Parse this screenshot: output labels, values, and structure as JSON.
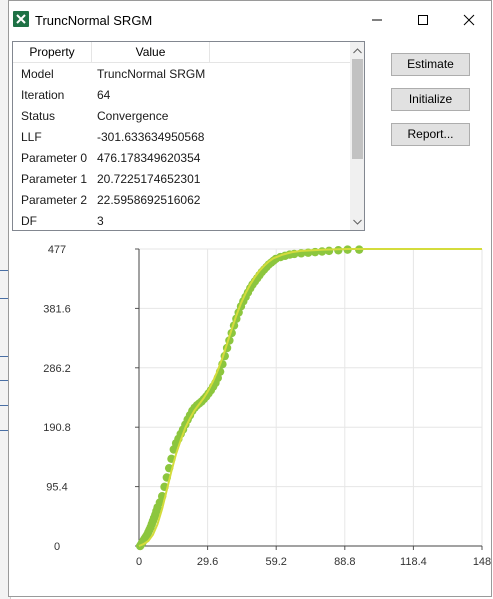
{
  "window": {
    "title": "TruncNormal SRGM"
  },
  "grid": {
    "headers": {
      "property": "Property",
      "value": "Value"
    },
    "rows": [
      {
        "property": "Model",
        "value": "TruncNormal SRGM"
      },
      {
        "property": "Iteration",
        "value": "64"
      },
      {
        "property": "Status",
        "value": "Convergence"
      },
      {
        "property": "LLF",
        "value": "-301.633634950568"
      },
      {
        "property": "Parameter 0",
        "value": "476.178349620354"
      },
      {
        "property": "Parameter 1",
        "value": "20.7225174652301"
      },
      {
        "property": "Parameter 2",
        "value": "22.5958692516062"
      },
      {
        "property": "DF",
        "value": "3"
      }
    ]
  },
  "buttons": {
    "estimate": "Estimate",
    "initialize": "Initialize",
    "report": "Report..."
  },
  "colors": {
    "data_points": "#8cc63e",
    "fitted_line": "#d4dc3c",
    "grid": "#e6e6e6"
  },
  "chart_data": {
    "type": "scatter",
    "x_ticks": [
      "0",
      "29.6",
      "59.2",
      "88.8",
      "118.4",
      "148"
    ],
    "y_ticks": [
      "477",
      "381.6",
      "286.2",
      "190.8",
      "95.4",
      "0"
    ],
    "xlim": [
      0,
      148
    ],
    "ylim": [
      0,
      477
    ],
    "grid": true,
    "series": [
      {
        "type": "scatter",
        "points": [
          [
            0.5,
            0
          ],
          [
            1,
            3
          ],
          [
            1.5,
            6
          ],
          [
            2,
            9
          ],
          [
            2.5,
            12
          ],
          [
            3,
            15
          ],
          [
            3.5,
            18
          ],
          [
            4,
            22
          ],
          [
            4.5,
            26
          ],
          [
            5,
            30
          ],
          [
            5.5,
            35
          ],
          [
            6,
            40
          ],
          [
            6.5,
            45
          ],
          [
            7,
            50
          ],
          [
            7.5,
            56
          ],
          [
            8,
            62
          ],
          [
            9,
            70
          ],
          [
            10,
            80
          ],
          [
            11,
            95
          ],
          [
            12,
            110
          ],
          [
            13,
            125
          ],
          [
            14,
            140
          ],
          [
            15,
            155
          ],
          [
            16,
            165
          ],
          [
            17,
            172
          ],
          [
            18,
            180
          ],
          [
            19,
            187
          ],
          [
            20,
            195
          ],
          [
            21,
            203
          ],
          [
            22,
            210
          ],
          [
            23,
            217
          ],
          [
            24,
            222
          ],
          [
            25,
            226
          ],
          [
            26,
            229
          ],
          [
            27,
            232
          ],
          [
            28,
            236
          ],
          [
            29,
            240
          ],
          [
            30,
            245
          ],
          [
            31,
            250
          ],
          [
            32,
            256
          ],
          [
            33,
            262
          ],
          [
            34,
            270
          ],
          [
            35,
            280
          ],
          [
            36,
            292
          ],
          [
            37,
            305
          ],
          [
            38,
            318
          ],
          [
            39,
            330
          ],
          [
            40,
            342
          ],
          [
            41,
            354
          ],
          [
            42,
            365
          ],
          [
            43,
            375
          ],
          [
            44,
            385
          ],
          [
            45,
            393
          ],
          [
            46,
            400
          ],
          [
            47,
            407
          ],
          [
            48,
            414
          ],
          [
            49,
            420
          ],
          [
            50,
            425
          ],
          [
            51,
            430
          ],
          [
            52,
            435
          ],
          [
            53,
            440
          ],
          [
            54,
            444
          ],
          [
            55,
            448
          ],
          [
            56,
            452
          ],
          [
            57,
            455
          ],
          [
            58,
            458
          ],
          [
            59,
            461
          ],
          [
            61,
            464
          ],
          [
            63,
            466
          ],
          [
            65,
            468
          ],
          [
            67,
            469
          ],
          [
            70,
            470
          ],
          [
            73,
            471
          ],
          [
            76,
            472
          ],
          [
            79,
            473
          ],
          [
            82,
            474
          ],
          [
            86,
            475
          ],
          [
            90,
            476
          ],
          [
            95,
            476
          ]
        ]
      },
      {
        "type": "line",
        "points": [
          [
            0,
            0
          ],
          [
            2,
            3
          ],
          [
            4,
            8
          ],
          [
            6,
            18
          ],
          [
            8,
            35
          ],
          [
            10,
            60
          ],
          [
            12,
            90
          ],
          [
            14,
            120
          ],
          [
            16,
            148
          ],
          [
            18,
            170
          ],
          [
            20,
            190
          ],
          [
            22,
            205
          ],
          [
            24,
            218
          ],
          [
            26,
            228
          ],
          [
            28,
            238
          ],
          [
            30,
            250
          ],
          [
            32,
            265
          ],
          [
            34,
            282
          ],
          [
            36,
            302
          ],
          [
            38,
            325
          ],
          [
            40,
            348
          ],
          [
            42,
            370
          ],
          [
            44,
            390
          ],
          [
            46,
            406
          ],
          [
            48,
            420
          ],
          [
            50,
            432
          ],
          [
            52,
            442
          ],
          [
            54,
            450
          ],
          [
            56,
            457
          ],
          [
            58,
            462
          ],
          [
            62,
            468
          ],
          [
            66,
            472
          ],
          [
            70,
            474
          ],
          [
            80,
            476
          ],
          [
            90,
            477
          ],
          [
            100,
            477
          ],
          [
            120,
            477
          ],
          [
            148,
            477
          ]
        ]
      }
    ]
  }
}
